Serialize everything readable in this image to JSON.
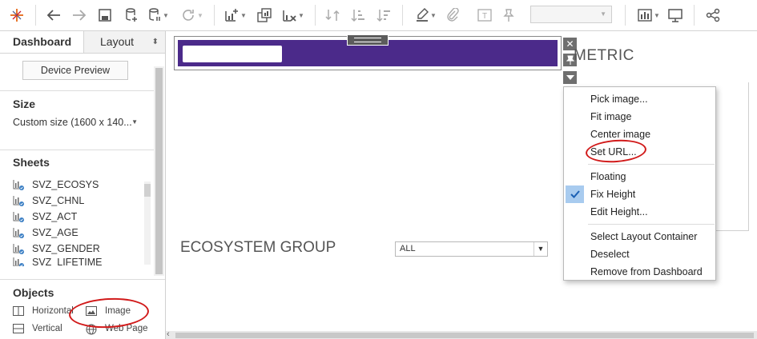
{
  "toolbar": {
    "icons": [
      "tableau-logo-icon",
      "undo-icon",
      "redo-icon",
      "save-icon",
      "new-datasource-icon",
      "pause-updates-icon",
      "refresh-icon",
      "new-sheet-icon",
      "duplicate-sheet-icon",
      "clear-sheet-icon",
      "swap-icon",
      "sort-asc-icon",
      "sort-desc-icon",
      "highlight-icon",
      "group-icon",
      "label-icon",
      "pin-icon",
      "show-me-icon",
      "presentation-icon",
      "share-icon"
    ],
    "fit_value": ""
  },
  "left_panel": {
    "tabs": {
      "dashboard": "Dashboard",
      "layout": "Layout"
    },
    "device_preview_label": "Device Preview",
    "size": {
      "title": "Size",
      "value": "Custom size (1600 x 140..."
    },
    "sheets": {
      "title": "Sheets",
      "items": [
        "SVZ_ECOSYS",
        "SVZ_CHNL",
        "SVZ_ACT",
        "SVZ_AGE",
        "SVZ_GENDER",
        "SVZ_LIFETIME"
      ]
    },
    "objects": {
      "title": "Objects",
      "items": [
        {
          "label": "Horizontal",
          "icon": "horizontal-container-icon"
        },
        {
          "label": "Image",
          "icon": "image-icon"
        },
        {
          "label": "Vertical",
          "icon": "vertical-container-icon"
        },
        {
          "label": "Web Page",
          "icon": "web-page-icon"
        }
      ]
    }
  },
  "canvas": {
    "metric_label": "METRIC",
    "ecosystem_label": "ECOSYSTEM GROUP",
    "filter_value": "ALL",
    "banner_color": "#4b2a8a"
  },
  "context_menu": {
    "group1": [
      "Pick image...",
      "Fit image",
      "Center image",
      "Set URL..."
    ],
    "group2": [
      {
        "label": "Floating",
        "checked": false
      },
      {
        "label": "Fix Height",
        "checked": true
      },
      {
        "label": "Edit Height...",
        "checked": false
      }
    ],
    "group3": [
      "Select Layout Container",
      "Deselect",
      "Remove from Dashboard"
    ]
  },
  "colors": {
    "accent": "#4b2a8a",
    "annotation": "#d11a1a",
    "check_highlight": "#a8cbef"
  }
}
